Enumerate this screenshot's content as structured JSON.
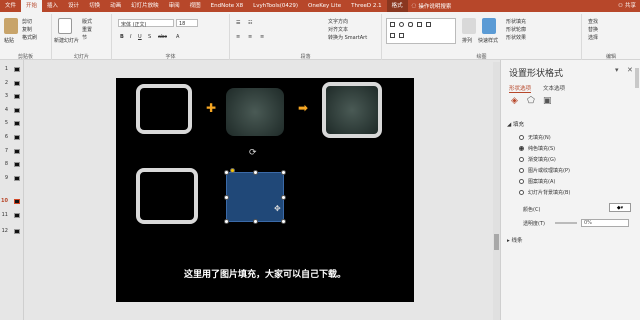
{
  "tabs": [
    "文件",
    "开始",
    "插入",
    "设计",
    "切换",
    "动画",
    "幻灯片放映",
    "审阅",
    "视图",
    "EndNote X8",
    "LvyhTools(0429)",
    "OneKey Lite",
    "ThreeD 2.1",
    "格式"
  ],
  "active_tab": "开始",
  "search_label": "操作说明搜索",
  "share_label": "共享",
  "ribbon": {
    "clipboard": {
      "paste": "粘贴",
      "cut": "剪切",
      "copy": "复制",
      "format_painter": "格式刷",
      "label": "剪贴板"
    },
    "slides": {
      "new_slide": "新建幻灯片",
      "layout": "版式",
      "reset": "重置",
      "section": "节",
      "label": "幻灯片"
    },
    "font": {
      "font_name": "宋体 (正文)",
      "font_size": "18",
      "label": "字体"
    },
    "paragraph": {
      "text_direction": "文字方向",
      "align_text": "对齐文本",
      "smartart": "转换为 SmartArt",
      "label": "段落"
    },
    "drawing": {
      "arrange": "排列",
      "quick_styles": "快速样式",
      "shape_fill": "形状填充",
      "shape_outline": "形状轮廓",
      "shape_effects": "形状效果",
      "label": "绘图"
    },
    "editing": {
      "find": "查找",
      "replace": "替换",
      "select": "选择",
      "label": "编辑"
    }
  },
  "slide_numbers": [
    "1",
    "2",
    "3",
    "4",
    "5",
    "6",
    "7",
    "8",
    "9",
    "10",
    "11",
    "12"
  ],
  "selected_slide": "10",
  "slide": {
    "plus": "✚",
    "arrow": "➡",
    "caption": "这里用了图片填充，大家可以自己下载。"
  },
  "pane": {
    "title": "设置形状格式",
    "tab_shape": "形状选项",
    "tab_text": "文本选项",
    "fill_header": "填充",
    "fill_options": [
      "无填充(N)",
      "纯色填充(S)",
      "渐变填充(G)",
      "图片或纹理填充(P)",
      "图案填充(A)",
      "幻灯片背景填充(B)"
    ],
    "selected_fill": "纯色填充(S)",
    "color_label": "颜色(C)",
    "transparency_label": "透明度(T)",
    "transparency_value": "0%",
    "line_header": "线条"
  },
  "colors": {
    "accent": "#b7472a",
    "shape_fill": "#204878",
    "orange": "#f5a623"
  }
}
